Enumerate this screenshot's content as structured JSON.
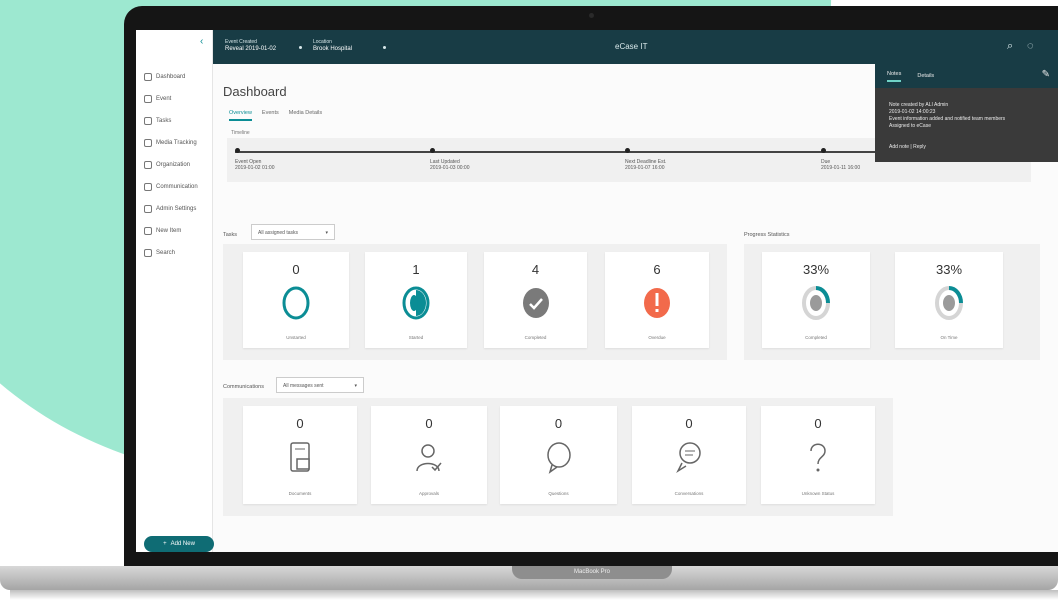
{
  "laptop": {
    "model": "MacBook Pro"
  },
  "topbar": {
    "context1_label": "Event Created",
    "context1_value": "Reveal 2019-01-02",
    "context2_label": "Location",
    "context2_value": "Brook Hospital",
    "app_title": "eCase IT",
    "search_icon": "search-icon",
    "chat_icon": "chat-icon"
  },
  "sidebar": {
    "collapse_icon": "chevron-left-icon",
    "items": [
      {
        "label": "Dashboard",
        "icon": "dashboard-icon"
      },
      {
        "label": "Event",
        "icon": "event-icon"
      },
      {
        "label": "Tasks",
        "icon": "tasks-icon"
      },
      {
        "label": "Media Tracking",
        "icon": "media-icon"
      },
      {
        "label": "Organization",
        "icon": "organization-icon"
      },
      {
        "label": "Communication",
        "icon": "communication-icon"
      },
      {
        "label": "Admin Settings",
        "icon": "settings-icon"
      },
      {
        "label": "New Item",
        "icon": "new-item-icon"
      },
      {
        "label": "Search",
        "icon": "search-icon"
      }
    ],
    "add_button": "Add New"
  },
  "page": {
    "title": "Dashboard",
    "tabs": [
      "Overview",
      "Events",
      "Media Details"
    ],
    "timeline_label": "Timeline",
    "timeline": [
      {
        "title": "Event Open",
        "date": "2019-01-02 01:00"
      },
      {
        "title": "Last Updated",
        "date": "2019-01-03 00:00"
      },
      {
        "title": "Next Deadline Est.",
        "date": "2019-01-07 16:00"
      },
      {
        "title": "Due",
        "date": "2019-01-11 16:00"
      }
    ],
    "tasks": {
      "label": "Tasks",
      "filter": "All assigned tasks",
      "cards": [
        {
          "count": "0",
          "label": "Unstarted",
          "icon": "unstarted-icon",
          "color": "#0b8d95"
        },
        {
          "count": "1",
          "label": "Started",
          "icon": "started-icon",
          "color": "#0b8d95"
        },
        {
          "count": "4",
          "label": "Completed",
          "icon": "check-icon",
          "color": "#7a7a7a"
        },
        {
          "count": "6",
          "label": "Overdue",
          "icon": "alert-icon",
          "color": "#f26a4b"
        }
      ]
    },
    "progress": {
      "label": "Progress Statistics",
      "cards": [
        {
          "value": "33%",
          "label": "Completed",
          "icon": "progress-ring-icon"
        },
        {
          "value": "33%",
          "label": "On Time",
          "icon": "progress-ring-icon"
        }
      ]
    },
    "communications": {
      "label": "Communications",
      "filter": "All messages sent",
      "cards": [
        {
          "count": "0",
          "label": "Documents",
          "icon": "document-icon"
        },
        {
          "count": "0",
          "label": "Approvals",
          "icon": "approval-icon"
        },
        {
          "count": "0",
          "label": "Questions",
          "icon": "chat-bubble-icon"
        },
        {
          "count": "0",
          "label": "Conversations",
          "icon": "conversation-icon"
        },
        {
          "count": "0",
          "label": "Unknown Status",
          "icon": "question-icon"
        }
      ]
    }
  },
  "overlay": {
    "tabs": [
      "Notes",
      "Details"
    ],
    "lines": [
      "Note created by ALI Admin",
      "2019-01-02 14:00:23",
      "Event information added and notified team members",
      "Assigned to eCase"
    ],
    "link": "Add note | Reply",
    "edit_icon": "edit-icon"
  }
}
